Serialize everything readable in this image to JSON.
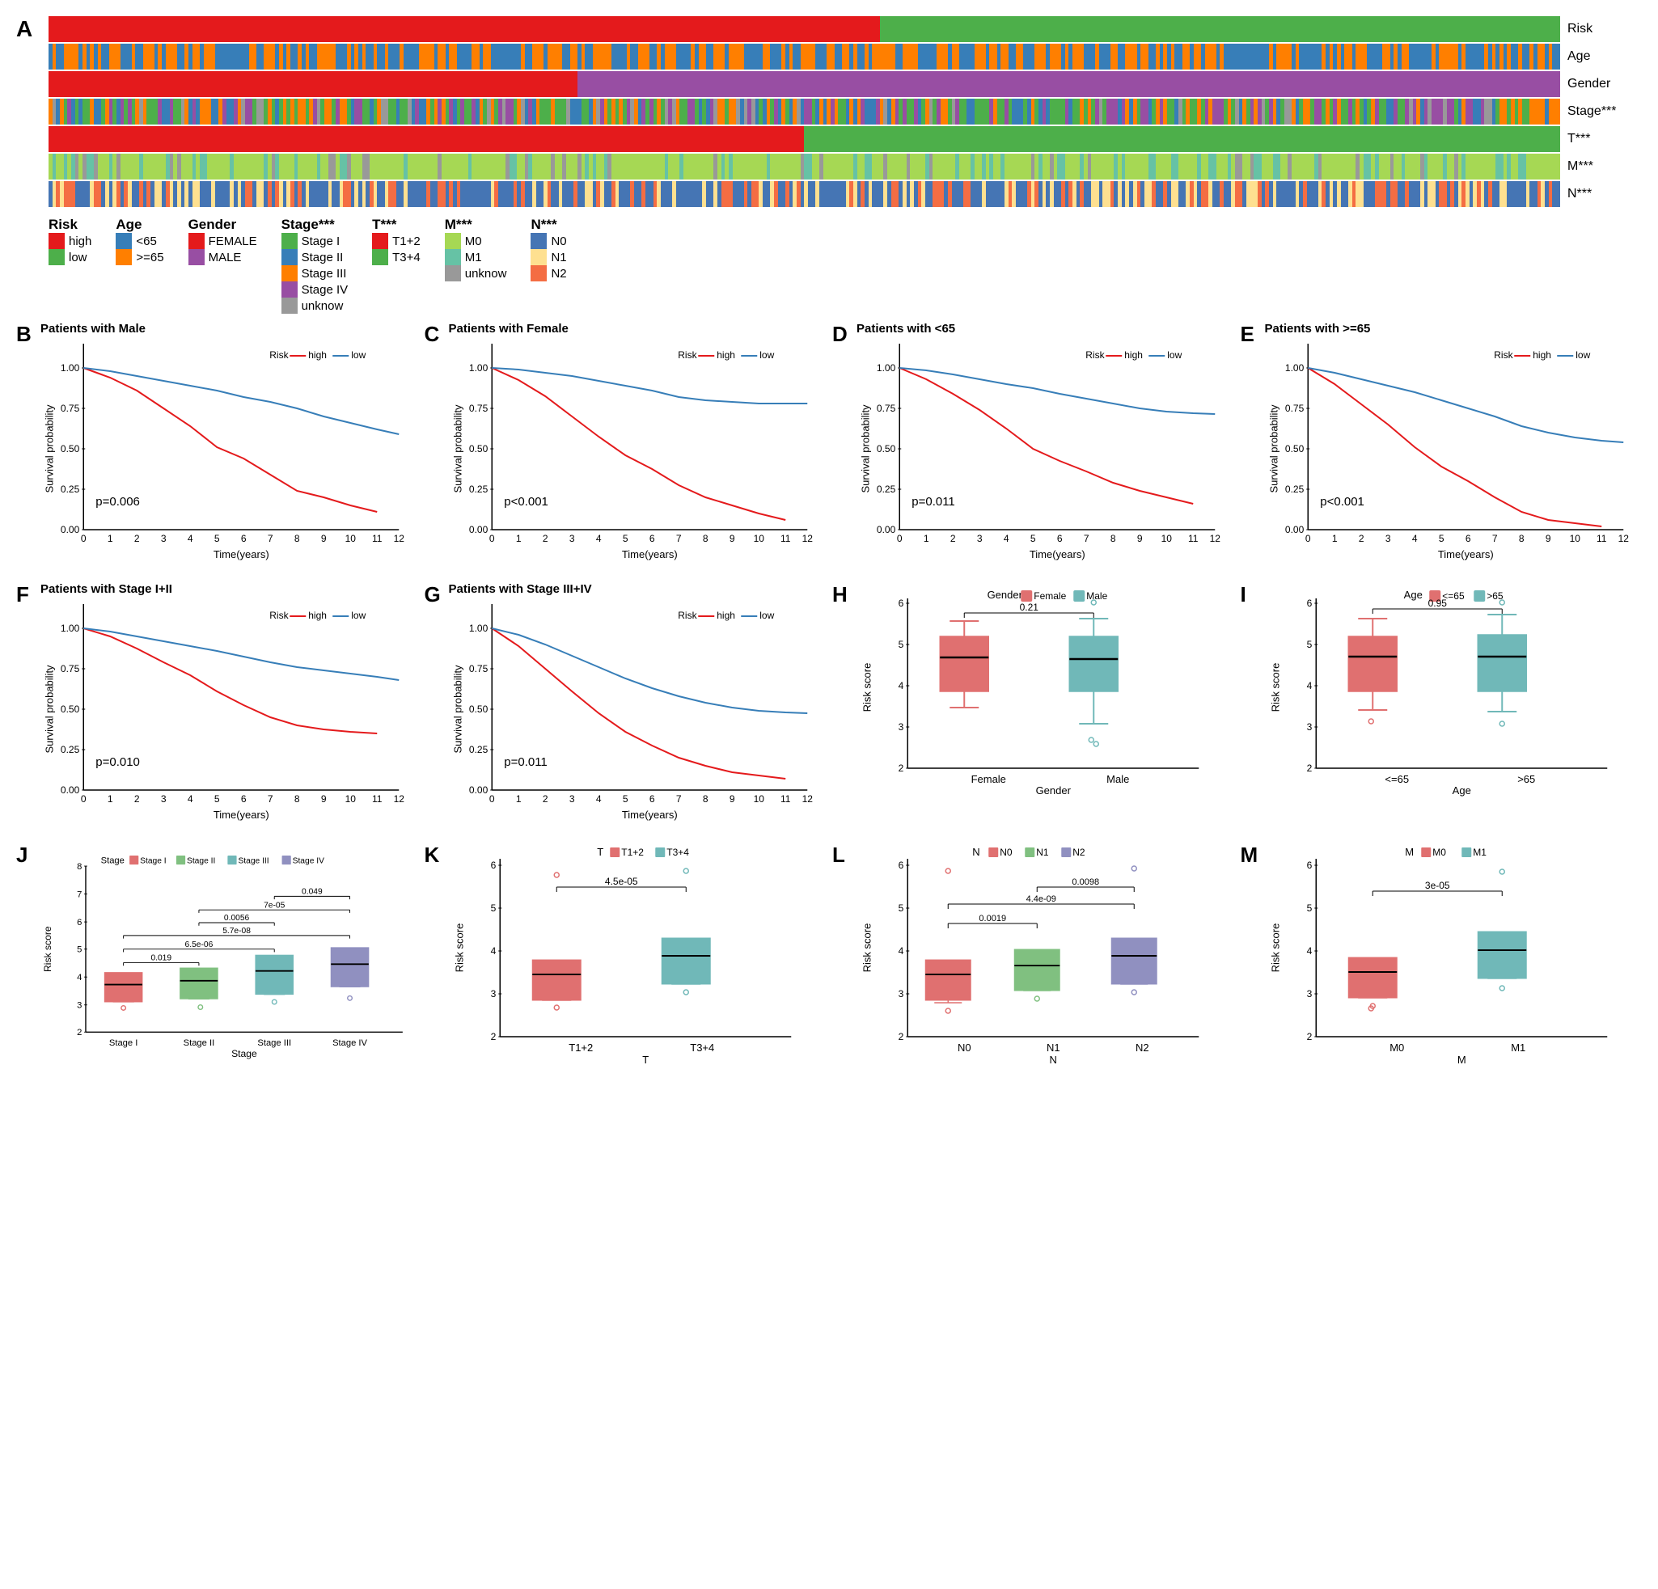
{
  "panel_a": {
    "label": "A",
    "rows": [
      {
        "label": "Risk",
        "colors": [
          "#e41a1c",
          "#4daf4a"
        ]
      },
      {
        "label": "Age",
        "colors": [
          "#377eb8",
          "#ff7f00"
        ]
      },
      {
        "label": "Gender",
        "colors": [
          "#e41a1c",
          "#984ea3"
        ]
      },
      {
        "label": "Stage***",
        "colors": [
          "#4daf4a",
          "#377eb8",
          "#ff7f00",
          "#984ea3",
          "#999999"
        ]
      },
      {
        "label": "T***",
        "colors": [
          "#e41a1c",
          "#4daf4a"
        ]
      },
      {
        "label": "M***",
        "colors": [
          "#a6d854",
          "#66c2a5",
          "#999999"
        ]
      },
      {
        "label": "N***",
        "colors": [
          "#4575b4",
          "#fee090",
          "#f46d43"
        ]
      }
    ],
    "legend": {
      "risk": {
        "title": "Risk",
        "items": [
          {
            "color": "#e41a1c",
            "label": "high"
          },
          {
            "color": "#4daf4a",
            "label": "low"
          }
        ]
      },
      "age": {
        "title": "Age",
        "items": [
          {
            "color": "#377eb8",
            "label": "<65"
          },
          {
            "color": "#ff7f00",
            "label": ">=65"
          }
        ]
      },
      "gender": {
        "title": "Gender",
        "items": [
          {
            "color": "#e41a1c",
            "label": "FEMALE"
          },
          {
            "color": "#984ea3",
            "label": "MALE"
          }
        ]
      },
      "stage": {
        "title": "Stage***",
        "items": [
          {
            "color": "#4daf4a",
            "label": "Stage I"
          },
          {
            "color": "#377eb8",
            "label": "Stage II"
          },
          {
            "color": "#ff7f00",
            "label": "Stage III"
          },
          {
            "color": "#984ea3",
            "label": "Stage IV"
          },
          {
            "color": "#999999",
            "label": "unknow"
          }
        ]
      },
      "t": {
        "title": "T***",
        "items": [
          {
            "color": "#e41a1c",
            "label": "T1+2"
          },
          {
            "color": "#4daf4a",
            "label": "T3+4"
          }
        ]
      },
      "m": {
        "title": "M***",
        "items": [
          {
            "color": "#a6d854",
            "label": "M0"
          },
          {
            "color": "#66c2a5",
            "label": "M1"
          },
          {
            "color": "#999999",
            "label": "unknow"
          }
        ]
      },
      "n": {
        "title": "N***",
        "items": [
          {
            "color": "#4575b4",
            "label": "N0"
          },
          {
            "color": "#fee090",
            "label": "N1"
          },
          {
            "color": "#f46d43",
            "label": "N2"
          }
        ]
      }
    }
  },
  "panels": {
    "b": {
      "title": "Patients with Male",
      "pvalue": "p=0.006"
    },
    "c": {
      "title": "Patients with Female",
      "pvalue": "p<0.001"
    },
    "d": {
      "title": "Patients with <65",
      "pvalue": "p=0.011"
    },
    "e": {
      "title": "Patients with >=65",
      "pvalue": "p<0.001"
    },
    "f": {
      "title": "Patients with Stage I+II",
      "pvalue": "p=0.010"
    },
    "g": {
      "title": "Patients with Stage III+IV",
      "pvalue": "p=0.011"
    },
    "h": {
      "title": "",
      "legend_title": "Gender",
      "legend_items": [
        {
          "color": "#e07070",
          "label": "Female"
        },
        {
          "color": "#70b8b8",
          "label": "Male"
        }
      ],
      "stat": "0.21",
      "xlabel": "Gender",
      "ylabel": "Risk score",
      "xgroups": [
        "Female",
        "Male"
      ]
    },
    "i": {
      "title": "",
      "legend_title": "Age",
      "legend_items": [
        {
          "color": "#e07070",
          "label": "<=65"
        },
        {
          "color": "#70b8b8",
          "label": ">65"
        }
      ],
      "stat": "0.95",
      "xlabel": "Age",
      "ylabel": "Risk score",
      "xgroups": [
        "<=65",
        ">65"
      ]
    },
    "j": {
      "title": "",
      "legend_title": "Stage",
      "legend_items": [
        {
          "color": "#e07070",
          "label": "Stage I"
        },
        {
          "color": "#80c080",
          "label": "Stage II"
        },
        {
          "color": "#70b8b8",
          "label": "Stage III"
        },
        {
          "color": "#9090c0",
          "label": "Stage IV"
        }
      ],
      "stats": [
        "0.019",
        "6.5e-06",
        "5.7e-08",
        "0.0056",
        "7e-05",
        "0.049"
      ],
      "xlabel": "Stage",
      "ylabel": "Risk score",
      "xgroups": [
        "Stage I",
        "Stage II",
        "Stage III",
        "Stage IV"
      ]
    },
    "k": {
      "title": "",
      "legend_title": "T",
      "legend_items": [
        {
          "color": "#e07070",
          "label": "T1+2"
        },
        {
          "color": "#70b8b8",
          "label": "T3+4"
        }
      ],
      "stat": "4.5e-05",
      "xlabel": "T",
      "ylabel": "Risk score",
      "xgroups": [
        "T1+2",
        "T3+4"
      ]
    },
    "l": {
      "title": "",
      "legend_title": "N",
      "legend_items": [
        {
          "color": "#e07070",
          "label": "N0"
        },
        {
          "color": "#80c080",
          "label": "N1"
        },
        {
          "color": "#9090c0",
          "label": "N2"
        }
      ],
      "stats": [
        "0.0019",
        "4.4e-09",
        "0.0098"
      ],
      "xlabel": "N",
      "ylabel": "Risk score",
      "xgroups": [
        "N0",
        "N1",
        "N2"
      ]
    },
    "m": {
      "title": "",
      "legend_title": "M",
      "legend_items": [
        {
          "color": "#e07070",
          "label": "M0"
        },
        {
          "color": "#70b8b8",
          "label": "M1"
        }
      ],
      "stat": "3e-05",
      "xlabel": "M",
      "ylabel": "Risk score",
      "xgroups": [
        "M0",
        "M1"
      ]
    }
  },
  "axis": {
    "time_label": "Time(years)",
    "survival_label": "Survival probability",
    "risk_label": "Risk",
    "risk_high": "high",
    "risk_low": "low"
  }
}
